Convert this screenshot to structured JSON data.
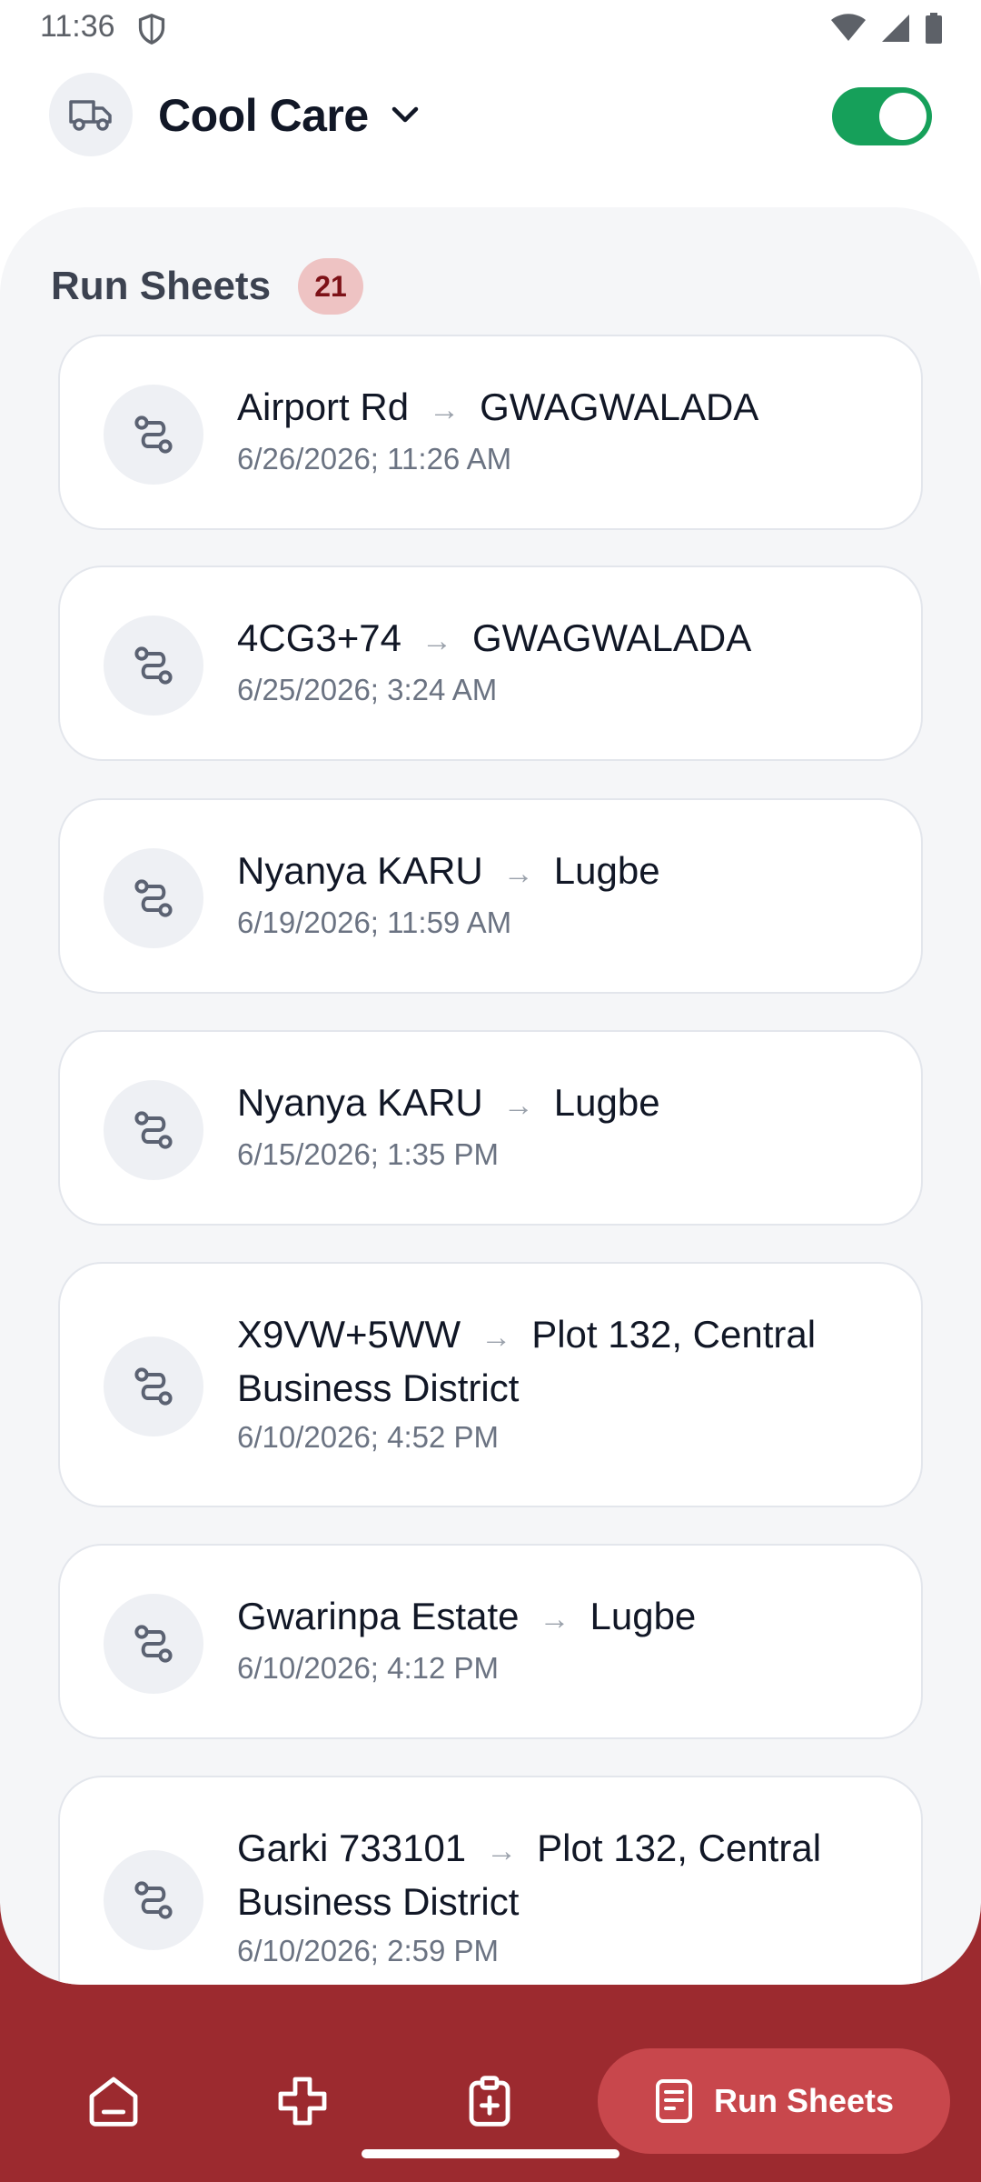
{
  "status_bar": {
    "time": "11:36"
  },
  "header": {
    "company": "Cool Care",
    "toggle_on": true
  },
  "section": {
    "title": "Run Sheets",
    "count": "21"
  },
  "run_sheets": [
    {
      "from": "Airport Rd",
      "to": "GWAGWALADA",
      "date": "6/26/2026; 11:26 AM"
    },
    {
      "from": "4CG3+74",
      "to": "GWAGWALADA",
      "date": "6/25/2026; 3:24 AM"
    },
    {
      "from": "Nyanya KARU",
      "to": "Lugbe",
      "date": "6/19/2026; 11:59 AM"
    },
    {
      "from": "Nyanya KARU",
      "to": "Lugbe",
      "date": "6/15/2026; 1:35 PM"
    },
    {
      "from": "X9VW+5WW",
      "to": "Plot 132, Central Business District",
      "date": "6/10/2026; 4:52 PM"
    },
    {
      "from": "Gwarinpa Estate",
      "to": "Lugbe",
      "date": "6/10/2026; 4:12 PM"
    },
    {
      "from": "Garki 733101",
      "to": "Plot 132, Central Business District",
      "date": "6/10/2026; 2:59 PM"
    }
  ],
  "route_arrow": "→",
  "bottom_nav": {
    "items": [
      "home-icon",
      "plus-icon",
      "clipboard-add-icon"
    ],
    "active_label": "Run Sheets"
  },
  "colors": {
    "accent": "#9c2a2f",
    "toggle": "#16a05a",
    "badge_bg": "#eec3c3"
  }
}
